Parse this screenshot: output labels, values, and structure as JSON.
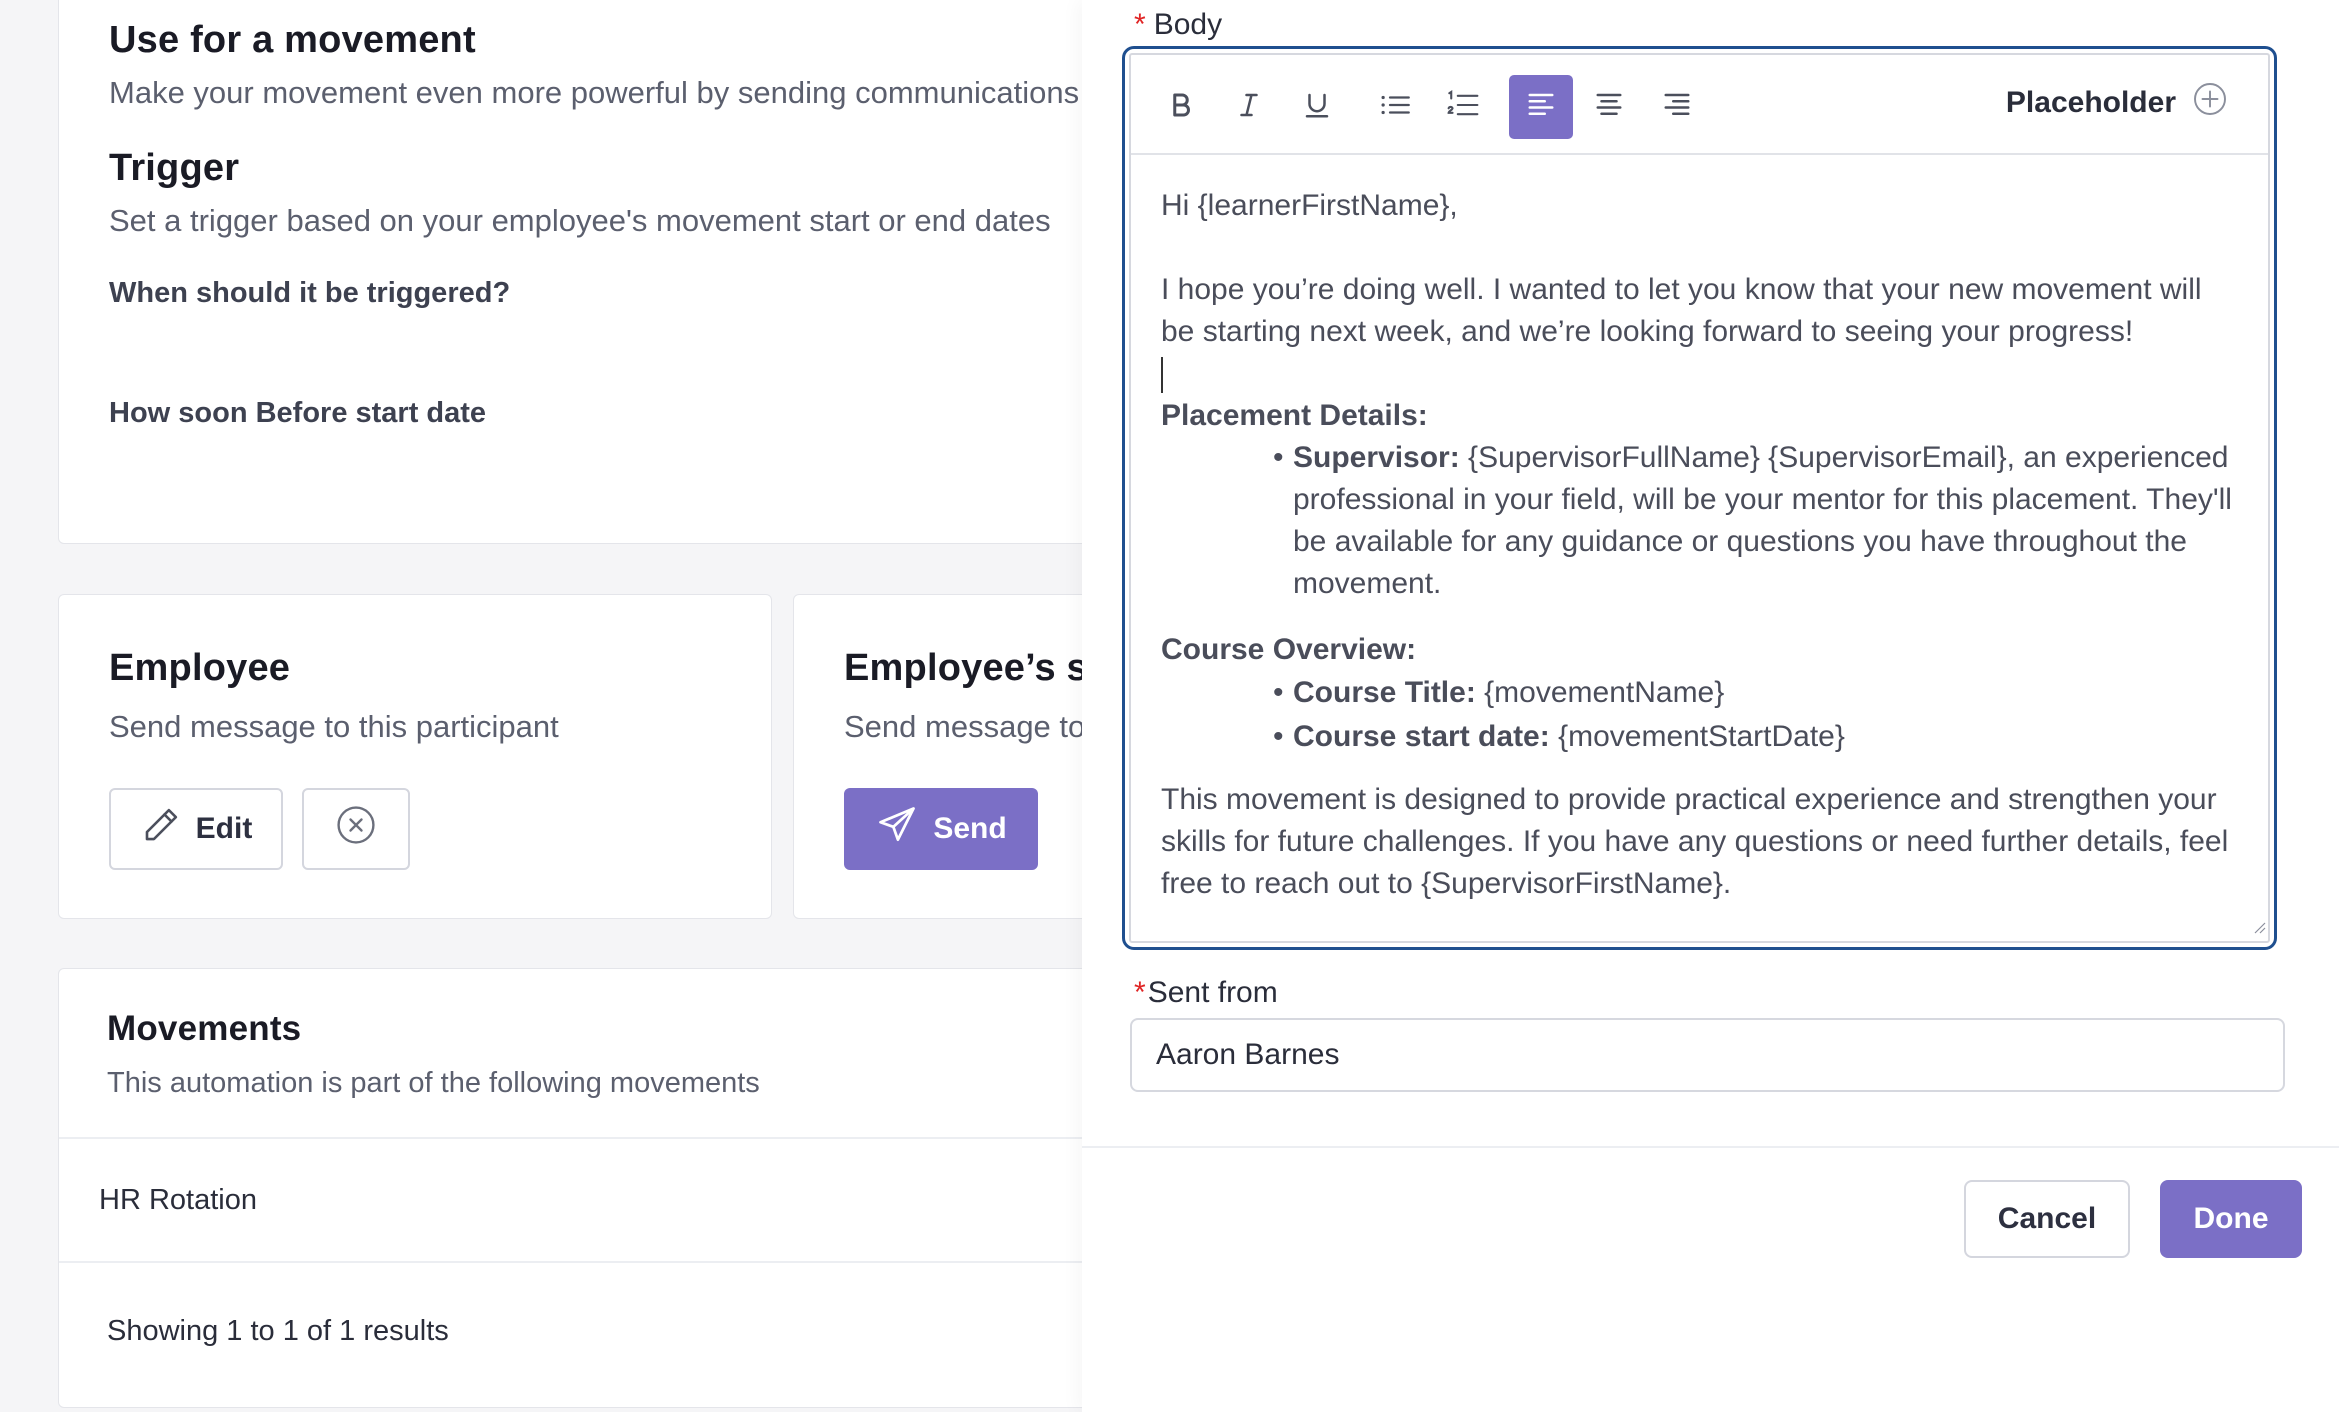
{
  "trigger_card": {
    "title": "Use for a movement",
    "subtitle": "Make your movement even more powerful by sending communications",
    "trigger_title": "Trigger",
    "trigger_subtitle": "Set a trigger based on your employee's movement start or end dates",
    "when_label": "When should it be triggered?",
    "how_soon_label": "How soon Before start date"
  },
  "employee_card": {
    "title": "Employee",
    "subtitle": "Send message to this participant",
    "edit_label": "Edit"
  },
  "supervisor_card": {
    "title": "Employee’s su",
    "subtitle": "Send message to",
    "send_label": "Send"
  },
  "movements_card": {
    "title": "Movements",
    "subtitle": "This automation is part of the following movements",
    "row": "HR Rotation",
    "results": "Showing 1 to 1 of 1 results"
  },
  "panel": {
    "body_label": "Body",
    "required_mark": "*",
    "placeholder_label": "Placeholder",
    "editor": {
      "greeting": "Hi {learnerFirstName},",
      "intro": "I hope you’re doing well. I wanted to let you know that your new movement will be starting next week, and we’re looking forward to seeing your progress!",
      "placement_heading": "Placement Details:",
      "supervisor_key": "Supervisor:",
      "supervisor_text": " {SupervisorFullName} {SupervisorEmail}, an experienced professional in your field, will be your mentor for this placement. They'll be available for any guidance or questions you have throughout the movement.",
      "course_heading": "Course Overview:",
      "course_title_key": "Course Title:",
      "course_title_val": " {movementName}",
      "course_start_key": "Course start date:",
      "course_start_val": " {movementStartDate}",
      "closing": "This movement is designed to provide practical experience and strengthen your skills for future challenges. If you have any questions or need further details, feel free to reach out to {SupervisorFirstName}."
    },
    "sent_from_label": "Sent from",
    "sent_from_value": "Aaron Barnes",
    "cancel_label": "Cancel",
    "done_label": "Done"
  },
  "colors": {
    "primary": "#7b6fc6",
    "focus_border": "#1f4f8f",
    "required": "#e02424"
  }
}
